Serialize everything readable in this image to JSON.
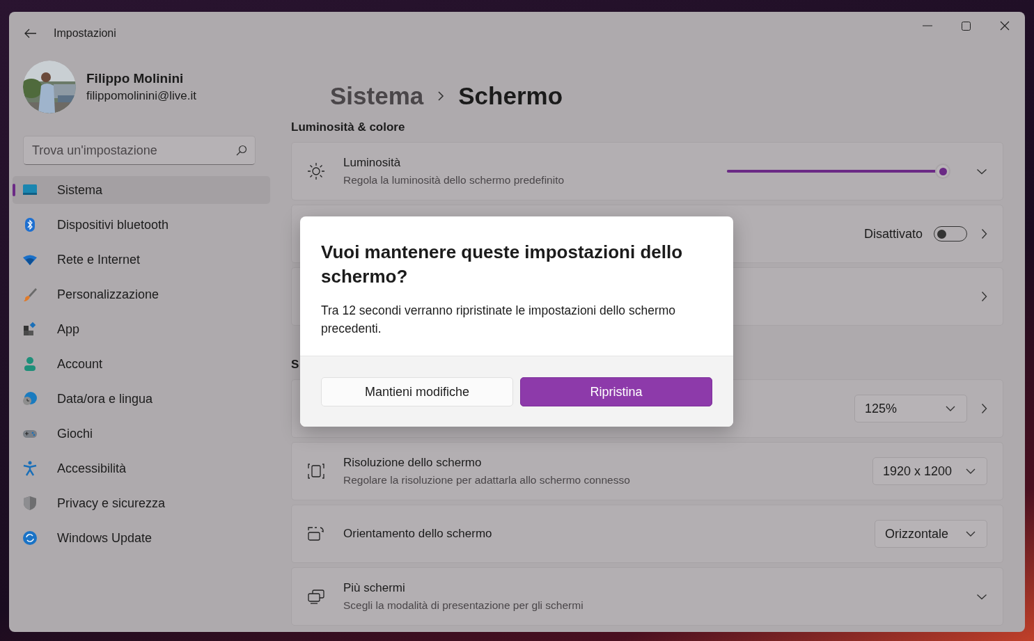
{
  "window": {
    "title": "Impostazioni"
  },
  "user": {
    "name": "Filippo Molinini",
    "email": "filippomolinini@live.it"
  },
  "search": {
    "placeholder": "Trova un'impostazione"
  },
  "nav": [
    {
      "label": "Sistema",
      "selected": true
    },
    {
      "label": "Dispositivi bluetooth",
      "selected": false
    },
    {
      "label": "Rete e Internet",
      "selected": false
    },
    {
      "label": "Personalizzazione",
      "selected": false
    },
    {
      "label": "App",
      "selected": false
    },
    {
      "label": "Account",
      "selected": false
    },
    {
      "label": "Data/ora e lingua",
      "selected": false
    },
    {
      "label": "Giochi",
      "selected": false
    },
    {
      "label": "Accessibilità",
      "selected": false
    },
    {
      "label": "Privacy e sicurezza",
      "selected": false
    },
    {
      "label": "Windows Update",
      "selected": false
    }
  ],
  "breadcrumb": {
    "parent": "Sistema",
    "current": "Schermo"
  },
  "sections": [
    {
      "heading": "Luminosità & colore",
      "cards": [
        {
          "kind": "slider",
          "title": "Luminosità",
          "subtitle": "Regola la luminosità dello schermo predefinito",
          "level": 0.97
        },
        {
          "kind": "toggle",
          "state_label": "Disattivato",
          "on": false
        },
        {
          "kind": "link"
        }
      ]
    },
    {
      "heading": "S",
      "cards": [
        {
          "kind": "dropdown",
          "value": "125%",
          "opens_page": true
        },
        {
          "kind": "dropdown",
          "title": "Risoluzione dello schermo",
          "subtitle": "Regolare la risoluzione per adattarla allo schermo connesso",
          "value": "1920 x 1200",
          "opens_page": false
        },
        {
          "kind": "dropdown",
          "title": "Orientamento dello schermo",
          "value": "Orizzontale",
          "opens_page": false
        },
        {
          "kind": "expander",
          "title": "Più schermi",
          "subtitle": "Scegli la modalità di presentazione per gli schermi"
        }
      ]
    }
  ],
  "dialog": {
    "title": "Vuoi mantenere queste impostazioni dello schermo?",
    "message": "Tra 12 secondi verranno ripristinate le impostazioni dello schermo precedenti.",
    "buttons": [
      {
        "label": "Mantieni modifiche",
        "primary": false
      },
      {
        "label": "Ripristina",
        "primary": true
      }
    ]
  }
}
